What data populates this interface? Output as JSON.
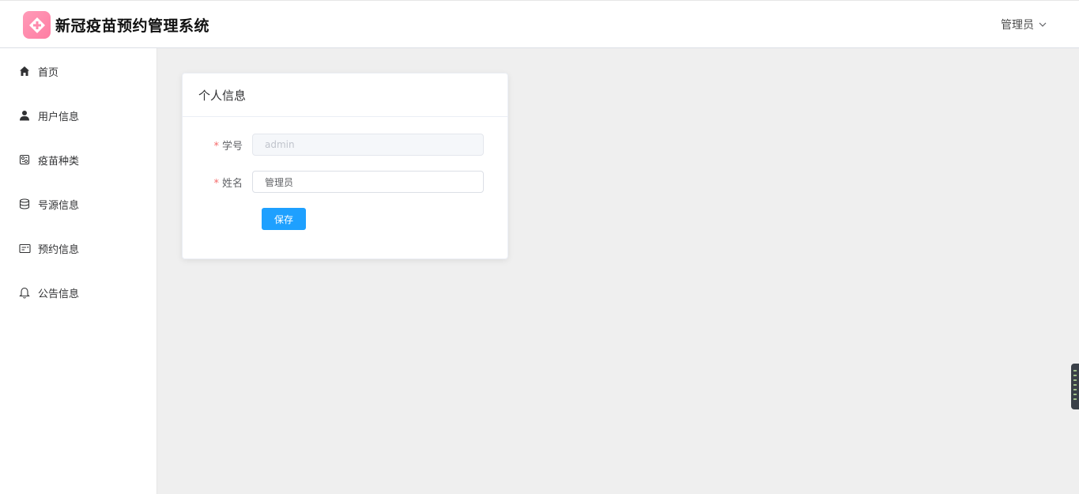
{
  "header": {
    "app_title": "新冠疫苗预约管理系统",
    "user_name": "管理员",
    "logo_icon": "medical-cross-icon"
  },
  "sidebar": {
    "items": [
      {
        "label": "首页",
        "icon": "home-icon"
      },
      {
        "label": "用户信息",
        "icon": "user-icon"
      },
      {
        "label": "疫苗种类",
        "icon": "vaccine-type-icon"
      },
      {
        "label": "号源信息",
        "icon": "database-icon"
      },
      {
        "label": "预约信息",
        "icon": "id-card-icon"
      },
      {
        "label": "公告信息",
        "icon": "bell-icon"
      }
    ]
  },
  "card": {
    "title": "个人信息",
    "fields": {
      "student_id": {
        "label": "学号",
        "value": "admin",
        "required": true,
        "disabled": true
      },
      "name": {
        "label": "姓名",
        "value": "管理员",
        "required": true,
        "disabled": false
      }
    },
    "required_mark": "*",
    "save_label": "保存"
  },
  "colors": {
    "primary": "#1ea0ff",
    "logo": "#ff8aad",
    "background": "#efefef",
    "required": "#f56c6c"
  }
}
